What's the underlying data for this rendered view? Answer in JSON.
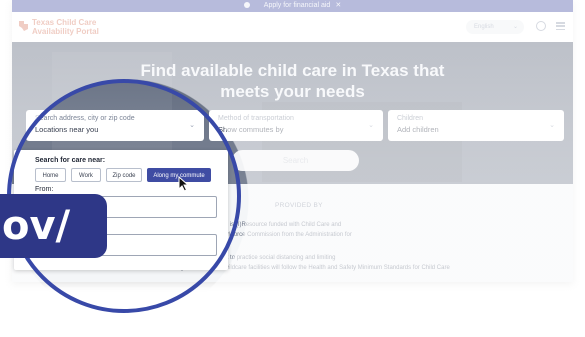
{
  "banner": {
    "text": "Apply for financial aid",
    "close": "✕"
  },
  "header": {
    "logo_line1": "Texas Child Care",
    "logo_line2": "Availability Portal",
    "language": "English",
    "menu_icon": "hamburger-icon",
    "globe_icon": "globe-icon"
  },
  "hero": {
    "headline_line1": "Find available child care in Texas that",
    "headline_line2": "meets your needs",
    "search_button": "Search"
  },
  "filters": {
    "location": {
      "label": "Search address, city or zip code",
      "value": "Locations near you"
    },
    "transport": {
      "label": "Method of transportation",
      "value": "Show commutes by"
    },
    "children": {
      "label": "Children",
      "value": "Add children"
    }
  },
  "care_panel": {
    "title": "Search for care near:",
    "options": [
      "Home",
      "Work",
      "Zip code",
      "Along my commute"
    ],
    "selected": "Along my commute",
    "from_label": "From:"
  },
  "info": {
    "provided_by": "PROVIDED BY",
    "paragraph1_line1": "this site, the Texas Child Care Availability Portal is (I)Resource funded with Child Care and",
    "paragraph1_line2": "is part of a 2021 CRRSA grant to the Texas Workforce Commission from the Administration for",
    "paragraph2_line1": "ity and its closes. It is important that we all work to practice social distancing and limiting",
    "paragraph2_line2": "our contacts with others during this time. Our childcare facilities will follow the Health and Safety Minimum Standards for Child Care"
  },
  "url_fragment": "ov/",
  "colors": {
    "accent": "#3f4ca3",
    "ring": "#3849a8",
    "badge": "#2e3787",
    "logo": "#d9826c"
  }
}
